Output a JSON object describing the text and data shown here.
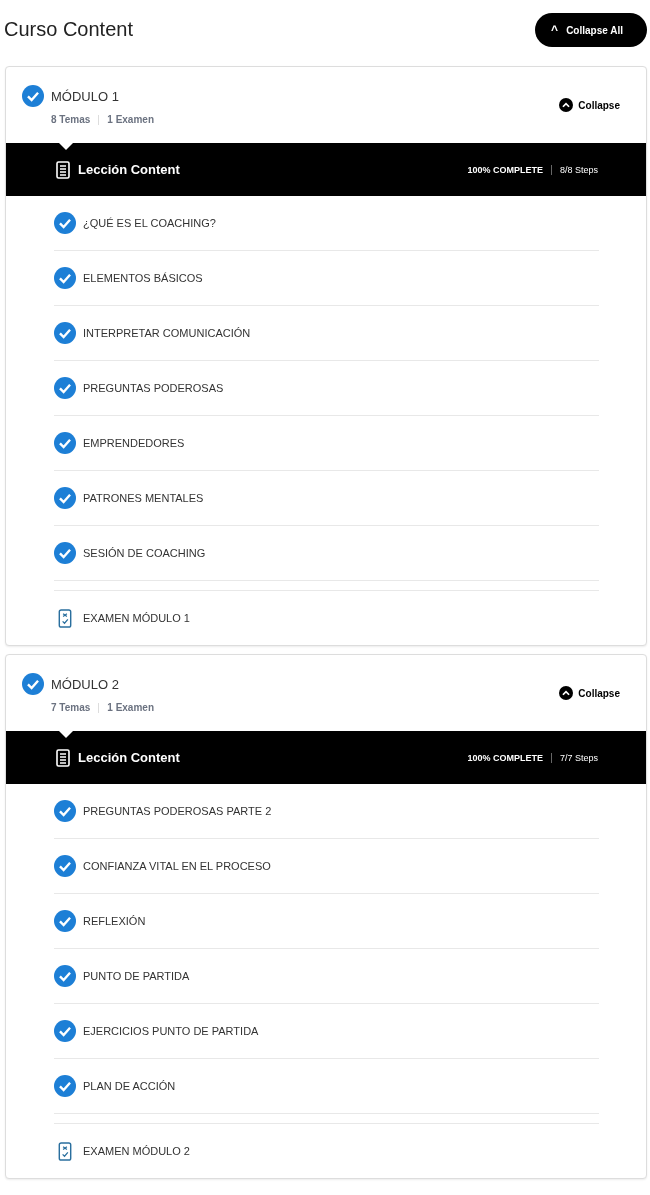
{
  "heading": "Curso Content",
  "collapse_all": {
    "icon": "^",
    "label": "Collapse All"
  },
  "modules": [
    {
      "title": "MÓDULO 1",
      "completed": true,
      "topics_count": "8 Temas",
      "exams_count": "1 Examen",
      "collapse_label": "Collapse",
      "expanded": true,
      "lesson_label": "Lección Content",
      "progress": "100% COMPLETE",
      "steps": "8/8 Steps",
      "items": [
        {
          "kind": "topic",
          "title": "¿QUÉ ES EL COACHING?",
          "completed": true
        },
        {
          "kind": "topic",
          "title": "ELEMENTOS BÁSICOS",
          "completed": true
        },
        {
          "kind": "topic",
          "title": "INTERPRETAR COMUNICACIÓN",
          "completed": true
        },
        {
          "kind": "topic",
          "title": "PREGUNTAS PODEROSAS",
          "completed": true
        },
        {
          "kind": "topic",
          "title": "EMPRENDEDORES",
          "completed": true
        },
        {
          "kind": "topic",
          "title": "PATRONES MENTALES",
          "completed": true
        },
        {
          "kind": "topic",
          "title": "SESIÓN DE COACHING",
          "completed": true
        },
        {
          "kind": "quiz",
          "title": "EXAMEN MÓDULO 1"
        }
      ]
    },
    {
      "title": "MÓDULO 2",
      "completed": true,
      "topics_count": "7 Temas",
      "exams_count": "1 Examen",
      "collapse_label": "Collapse",
      "expanded": true,
      "lesson_label": "Lección Content",
      "progress": "100% COMPLETE",
      "steps": "7/7 Steps",
      "items": [
        {
          "kind": "topic",
          "title": "PREGUNTAS PODEROSAS PARTE 2",
          "completed": true
        },
        {
          "kind": "topic",
          "title": "CONFIANZA VITAL EN EL PROCESO",
          "completed": true
        },
        {
          "kind": "topic",
          "title": "REFLEXIÓN",
          "completed": true
        },
        {
          "kind": "topic",
          "title": "PUNTO DE PARTIDA",
          "completed": true
        },
        {
          "kind": "topic",
          "title": "EJERCICIOS PUNTO DE PARTIDA",
          "completed": true
        },
        {
          "kind": "topic",
          "title": "PLAN DE ACCIÓN",
          "completed": true
        },
        {
          "kind": "quiz",
          "title": "EXAMEN MÓDULO 2"
        }
      ]
    }
  ]
}
